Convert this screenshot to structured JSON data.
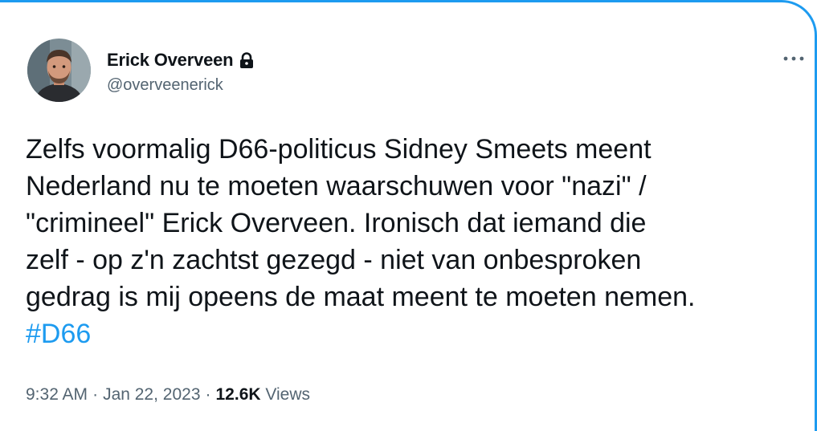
{
  "author": {
    "display_name": "Erick Overveen",
    "handle": "@overveenerick",
    "protected_icon": "lock-icon"
  },
  "more_icon": "more-horizontal-icon",
  "tweet": {
    "lines": [
      "Zelfs voormalig D66-politicus Sidney Smeets meent",
      "Nederland nu te moeten waarschuwen voor \"nazi\" /",
      "\"crimineel\" Erick Overveen. Ironisch dat iemand die",
      "zelf - op z'n zachtst gezegd - niet van onbesproken",
      "gedrag is mij opeens de maat meent te moeten nemen."
    ],
    "hashtag": "#D66"
  },
  "meta": {
    "time": "9:32 AM",
    "separator": "·",
    "date": "Jan 22, 2023",
    "views_count": "12.6K",
    "views_label": "Views"
  },
  "colors": {
    "accent": "#1d9bf0",
    "text": "#0f1419",
    "secondary": "#536471"
  }
}
